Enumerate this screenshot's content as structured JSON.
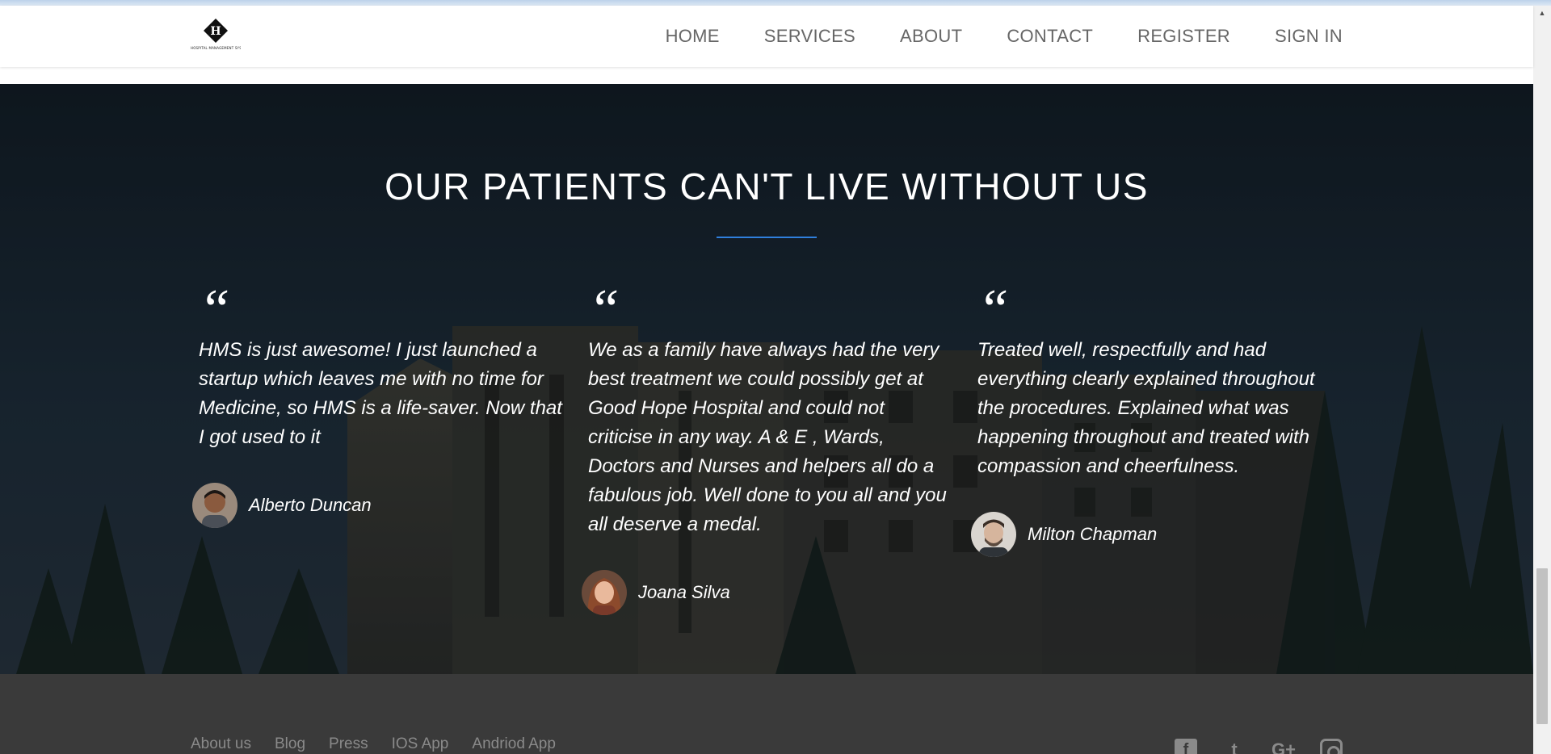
{
  "header": {
    "logo_letter": "H",
    "logo_caption": "HOSPITAL MANAGEMENT SYSTEM",
    "nav": [
      "HOME",
      "SERVICES",
      "ABOUT",
      "CONTACT",
      "REGISTER",
      "SIGN IN"
    ]
  },
  "testimonials": {
    "title": "OUR PATIENTS CAN'T LIVE WITHOUT US",
    "quote_mark": "“",
    "items": [
      {
        "text": "HMS is just awesome! I just launched a startup which leaves me with no time for Medicine, so HMS is a life-saver. Now that I got used to it",
        "author": "Alberto Duncan"
      },
      {
        "text": "We as a family have always had the very best treatment we could possibly get at Good Hope Hospital and could not criticise in any way. A & E , Wards, Doctors and Nurses and helpers all do a fabulous job. Well done to you all and you all deserve a medal.",
        "author": "Joana Silva"
      },
      {
        "text": "Treated well, respectfully and had everything clearly explained throughout the procedures. Explained what was happening throughout and treated with compassion and cheerfulness.",
        "author": "Milton Chapman"
      }
    ]
  },
  "footer": {
    "links": [
      "About us",
      "Blog",
      "Press",
      "IOS App",
      "Andriod App"
    ],
    "social": [
      "facebook-icon",
      "twitter-icon",
      "google-plus-icon",
      "instagram-icon"
    ],
    "social_glyphs": [
      "f",
      "t",
      "G+",
      ""
    ]
  },
  "colors": {
    "accent": "#2f7fdc",
    "footer_bg": "#3a3a3a",
    "nav_text": "#666666"
  }
}
